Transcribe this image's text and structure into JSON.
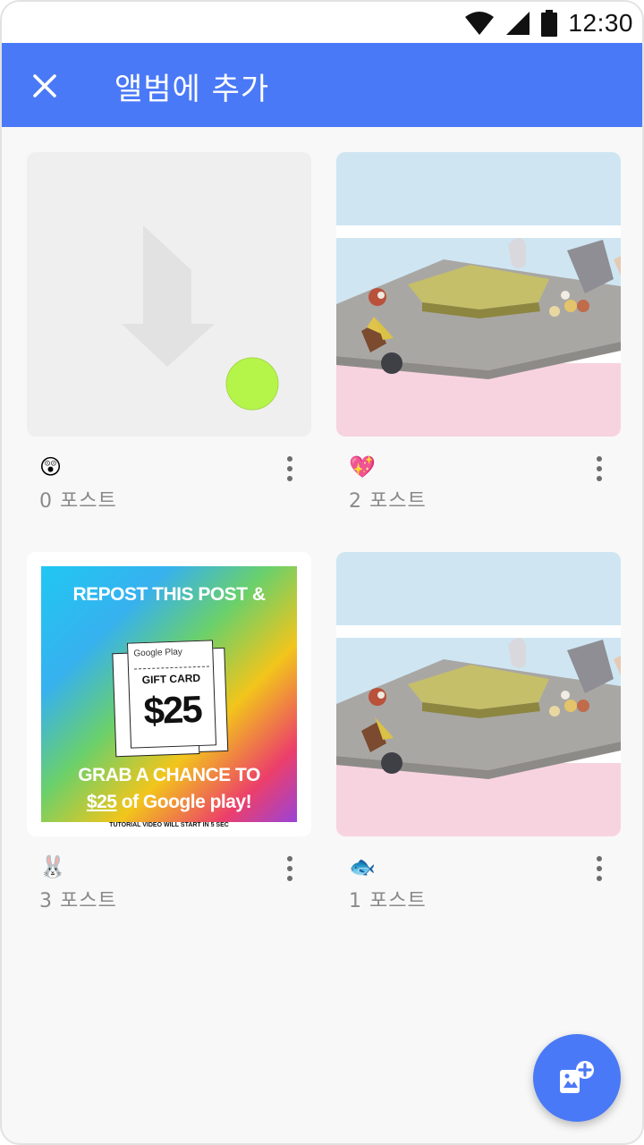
{
  "status_bar": {
    "time": "12:30"
  },
  "app_bar": {
    "title": "앨범에 추가"
  },
  "albums": [
    {
      "emoji": "😲",
      "count_label": "0 포스트",
      "thumbnail": "placeholder"
    },
    {
      "emoji": "💖",
      "count_label": "2 포스트",
      "thumbnail": "3d-scene"
    },
    {
      "emoji": "🐰",
      "count_label": "3 포스트",
      "thumbnail": "gift-card-promo"
    },
    {
      "emoji": "🐟",
      "count_label": "1 포스트",
      "thumbnail": "3d-scene"
    }
  ],
  "promo": {
    "headline": "REPOST THIS POST &",
    "store": "Google Play",
    "card_label": "GIFT CARD",
    "amount": "$25",
    "line1": "GRAB A CHANCE TO",
    "line2_amount": "$25",
    "line2_rest": " of Google play!",
    "footer": "TUTORIAL VIDEO WILL START IN 5 SEC"
  },
  "colors": {
    "app_bar": "#4a79f7",
    "fab": "#4a79f7",
    "placeholder_dot": "#b5f54a"
  },
  "icons": {
    "close": "close-icon",
    "more": "more-vert-icon",
    "fab": "add-photo-alternate-icon"
  }
}
